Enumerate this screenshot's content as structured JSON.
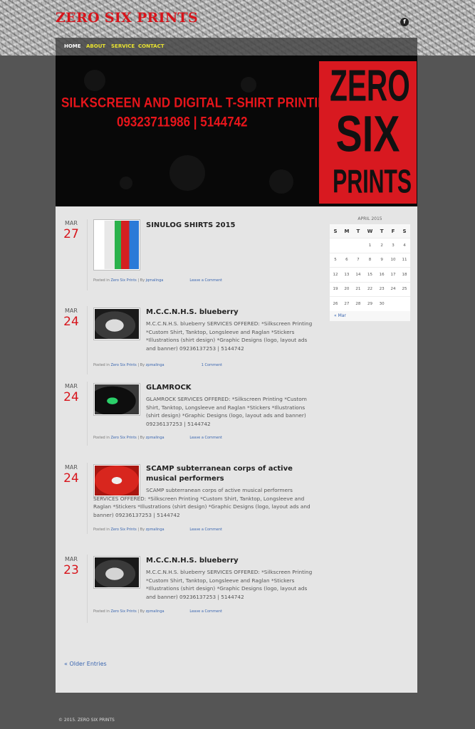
{
  "site": {
    "title": "ZERO SIX PRINTS",
    "social_icon": "facebook-icon",
    "social_glyph": "f"
  },
  "nav": {
    "items": [
      {
        "label": "HOME"
      },
      {
        "label": "ABOUT"
      },
      {
        "label": "SERVICE"
      },
      {
        "label": "CONTACT"
      }
    ]
  },
  "banner": {
    "tagline": "SILKSCREEN AND DIGITAL T-SHIRT PRINTING",
    "phones": "09323711986 | 5144742",
    "logo": {
      "line1": "ZERO",
      "line2": "SIX",
      "line3": "PRINTS"
    }
  },
  "posts": [
    {
      "month": "MAR",
      "day": "27",
      "title": "SINULOG SHIRTS 2015",
      "excerpt": "",
      "meta_prefix": "Posted in",
      "category": "Zero Six Prints",
      "meta_by": "| By",
      "author": "jqmalinga",
      "comments": "Leave a Comment"
    },
    {
      "month": "MAR",
      "day": "24",
      "title": "M.C.C.N.H.S. blueberry",
      "excerpt": "M.C.C.N.H.S. blueberry SERVICES OFFERED: *Silkscreen Printing *Custom Shirt, Tanktop, Longsleeve and Raglan *Stickers *Illustrations (shirt design) *Graphic Designs (logo, layout ads and banner) 09236137253 | 5144742",
      "meta_prefix": "Posted in",
      "category": "Zero Six Prints",
      "meta_by": "| By",
      "author": "zpmalinga",
      "comments": "1 Comment"
    },
    {
      "month": "MAR",
      "day": "24",
      "title": "GLAMROCK",
      "excerpt": "GLAMROCK SERVICES OFFERED: *Silkscreen Printing *Custom Shirt, Tanktop, Longsleeve and Raglan *Stickers *Illustrations (shirt design) *Graphic Designs (logo, layout ads and banner) 09236137253 | 5144742",
      "meta_prefix": "Posted in",
      "category": "Zero Six Prints",
      "meta_by": "| By",
      "author": "zpmalinga",
      "comments": "Leave a Comment"
    },
    {
      "month": "MAR",
      "day": "24",
      "title": "SCAMP subterranean corps of active musical performers",
      "excerpt": "SCAMP subterranean corps of active musical performers SERVICES OFFERED: *Silkscreen Printing *Custom Shirt, Tanktop, Longsleeve and Raglan *Stickers *Illustrations (shirt design) *Graphic Designs (logo, layout ads and banner) 09236137253 | 5144742",
      "meta_prefix": "Posted in",
      "category": "Zero Six Prints",
      "meta_by": "| By",
      "author": "zpmalinga",
      "comments": "Leave a Comment"
    },
    {
      "month": "MAR",
      "day": "23",
      "title": "M.C.C.N.H.S. blueberry",
      "excerpt": "M.C.C.N.H.S. blueberry SERVICES OFFERED: *Silkscreen Printing *Custom Shirt, Tanktop, Longsleeve and Raglan *Stickers *Illustrations (shirt design) *Graphic Designs (logo, layout ads and banner) 09236137253 | 5144742",
      "meta_prefix": "Posted in",
      "category": "Zero Six Prints",
      "meta_by": "| By",
      "author": "zpmalinga",
      "comments": "Leave a Comment"
    }
  ],
  "pagination": {
    "older": "« Older Entries"
  },
  "calendar": {
    "caption": "APRIL 2015",
    "weekdays": [
      "S",
      "M",
      "T",
      "W",
      "T",
      "F",
      "S"
    ],
    "weeks": [
      [
        "",
        "",
        "",
        "1",
        "2",
        "3",
        "4"
      ],
      [
        "5",
        "6",
        "7",
        "8",
        "9",
        "10",
        "11"
      ],
      [
        "12",
        "13",
        "14",
        "15",
        "16",
        "17",
        "18"
      ],
      [
        "19",
        "20",
        "21",
        "22",
        "23",
        "24",
        "25"
      ],
      [
        "26",
        "27",
        "28",
        "29",
        "30",
        "",
        ""
      ]
    ],
    "prev": "« Mar"
  },
  "footer": {
    "text": "© 2015. ZERO SIX PRINTS"
  },
  "colors": {
    "brand_red": "#d7141b",
    "nav_link": "#e8e230",
    "link_blue": "#3a66b0"
  }
}
